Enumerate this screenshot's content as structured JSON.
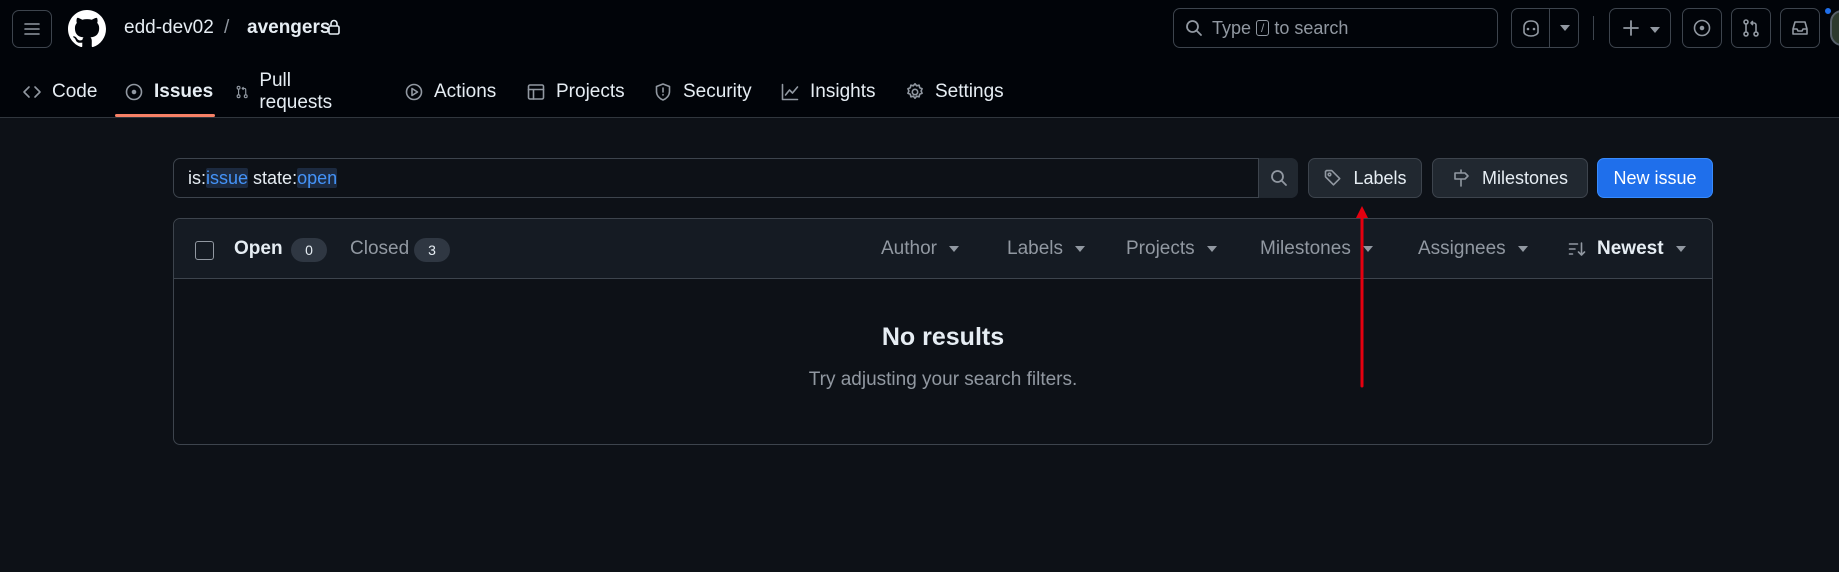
{
  "header": {
    "owner": "edd-dev02",
    "separator": "/",
    "repo": "avengers",
    "search_prefix": "Type",
    "search_key": "/",
    "search_suffix": "to search"
  },
  "nav": {
    "tabs": [
      {
        "label": "Code",
        "icon": "code-icon"
      },
      {
        "label": "Issues",
        "icon": "issue-opened-icon",
        "active": true
      },
      {
        "label": "Pull requests",
        "icon": "git-pull-request-icon"
      },
      {
        "label": "Actions",
        "icon": "play-icon"
      },
      {
        "label": "Projects",
        "icon": "table-icon"
      },
      {
        "label": "Security",
        "icon": "shield-icon"
      },
      {
        "label": "Insights",
        "icon": "graph-icon"
      },
      {
        "label": "Settings",
        "icon": "gear-icon"
      }
    ]
  },
  "filter": {
    "is_key": "is:",
    "is_value": "issue",
    "state_key": "state:",
    "state_value": "open"
  },
  "buttons": {
    "labels": "Labels",
    "milestones": "Milestones",
    "new_issue": "New issue"
  },
  "list": {
    "open_label": "Open",
    "open_count": "0",
    "closed_label": "Closed",
    "closed_count": "3",
    "filters": [
      "Author",
      "Labels",
      "Projects",
      "Milestones",
      "Assignees"
    ],
    "sort": "Newest",
    "empty_title": "No results",
    "empty_subtitle": "Try adjusting your search filters."
  },
  "colors": {
    "accent": "#1f6feb",
    "tab_underline": "#f78166",
    "annotation_arrow": "#e5000f"
  }
}
